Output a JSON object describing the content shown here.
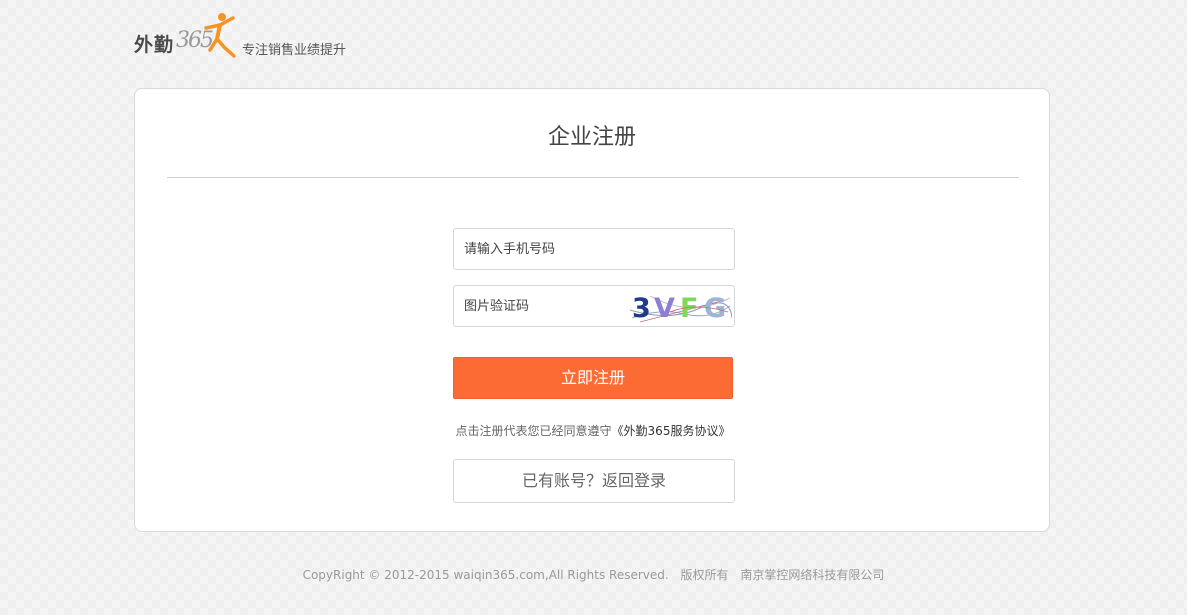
{
  "header": {
    "logo_text": "外勤",
    "logo_num": "365",
    "slogan": "专注销售业绩提升"
  },
  "form": {
    "title": "企业注册",
    "phone_placeholder": "请输入手机号码",
    "captcha_placeholder": "图片验证码",
    "captcha_text": "3VFG",
    "register_label": "立即注册",
    "agreement_prefix": "点击注册代表您已经同意遵守",
    "agreement_link": "《外勤365服务协议》",
    "login_label": "已有账号？返回登录"
  },
  "footer": {
    "copyright": "CopyRight © 2012-2015 waiqin365.com,All Rights Reserved.",
    "rights": "版权所有",
    "company": "南京掌控网络科技有限公司"
  },
  "colors": {
    "accent": "#fd6b35",
    "logo_orange": "#f39423",
    "background": "#efefef"
  }
}
